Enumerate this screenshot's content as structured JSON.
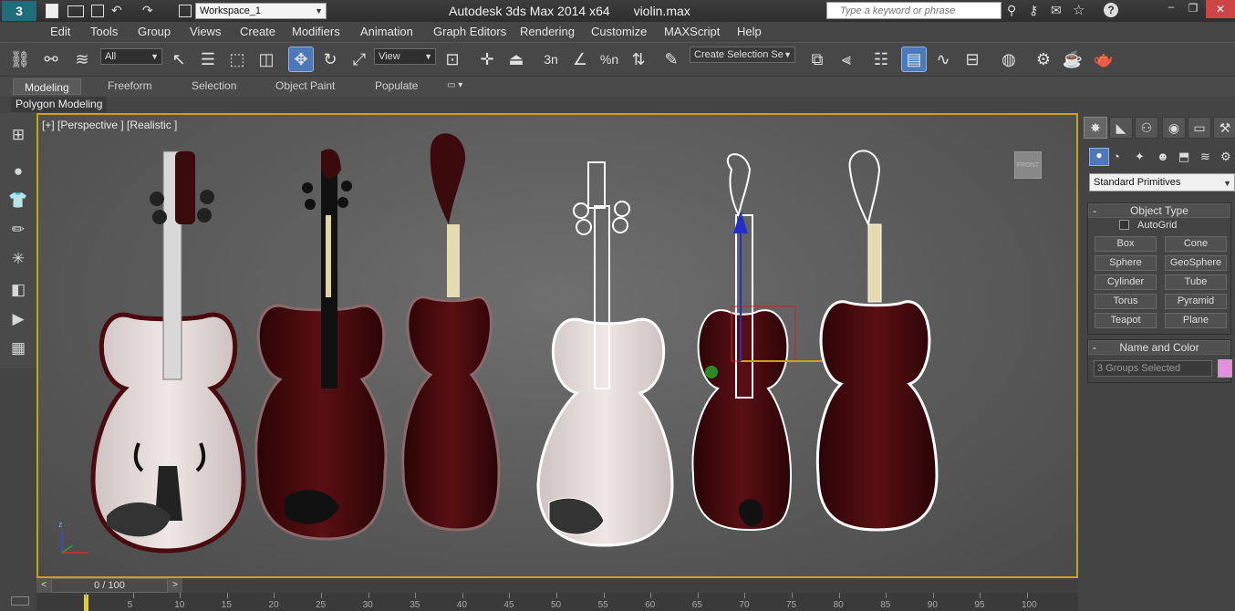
{
  "app": {
    "title": "Autodesk 3ds Max  2014 x64",
    "file": "violin.max",
    "workspace": "Workspace_1",
    "search_placeholder": "Type a keyword or phrase"
  },
  "menu": [
    "Edit",
    "Tools",
    "Group",
    "Views",
    "Create",
    "Modifiers",
    "Animation",
    "Graph Editors",
    "Rendering",
    "Customize",
    "MAXScript",
    "Help"
  ],
  "toolbar": {
    "filter": "All",
    "refcoord": "View",
    "selection_set": "Create Selection Se",
    "snap_labels": [
      "3n",
      "%n"
    ]
  },
  "ribbon": {
    "tabs": [
      "Modeling",
      "Freeform",
      "Selection",
      "Object Paint",
      "Populate"
    ],
    "active_tab": "Modeling",
    "sub_label": "Polygon Modeling"
  },
  "viewport": {
    "label": "[+] [Perspective ] [Realistic ]",
    "viewcube_label": "FRONT",
    "axis_z": "z"
  },
  "cmdpanel": {
    "category": "Standard Primitives",
    "object_type_title": "Object Type",
    "autogrid": "AutoGrid",
    "buttons": [
      "Box",
      "Cone",
      "Sphere",
      "GeoSphere",
      "Cylinder",
      "Tube",
      "Torus",
      "Pyramid",
      "Teapot",
      "Plane"
    ],
    "name_color_title": "Name and Color",
    "name_value": "3 Groups Selected",
    "swatch_color": "#e58ee0"
  },
  "timeline": {
    "frame_label": "0 / 100",
    "ticks": [
      "0",
      "5",
      "10",
      "15",
      "20",
      "25",
      "30",
      "35",
      "40",
      "45",
      "50",
      "55",
      "60",
      "65",
      "70",
      "75",
      "80",
      "85",
      "90",
      "95",
      "100"
    ]
  },
  "colors": {
    "viewport_border": "#c8a31a",
    "active_button": "#4e79b8",
    "violin_wood": "#4a0a0e",
    "violin_white": "#e8dede"
  }
}
